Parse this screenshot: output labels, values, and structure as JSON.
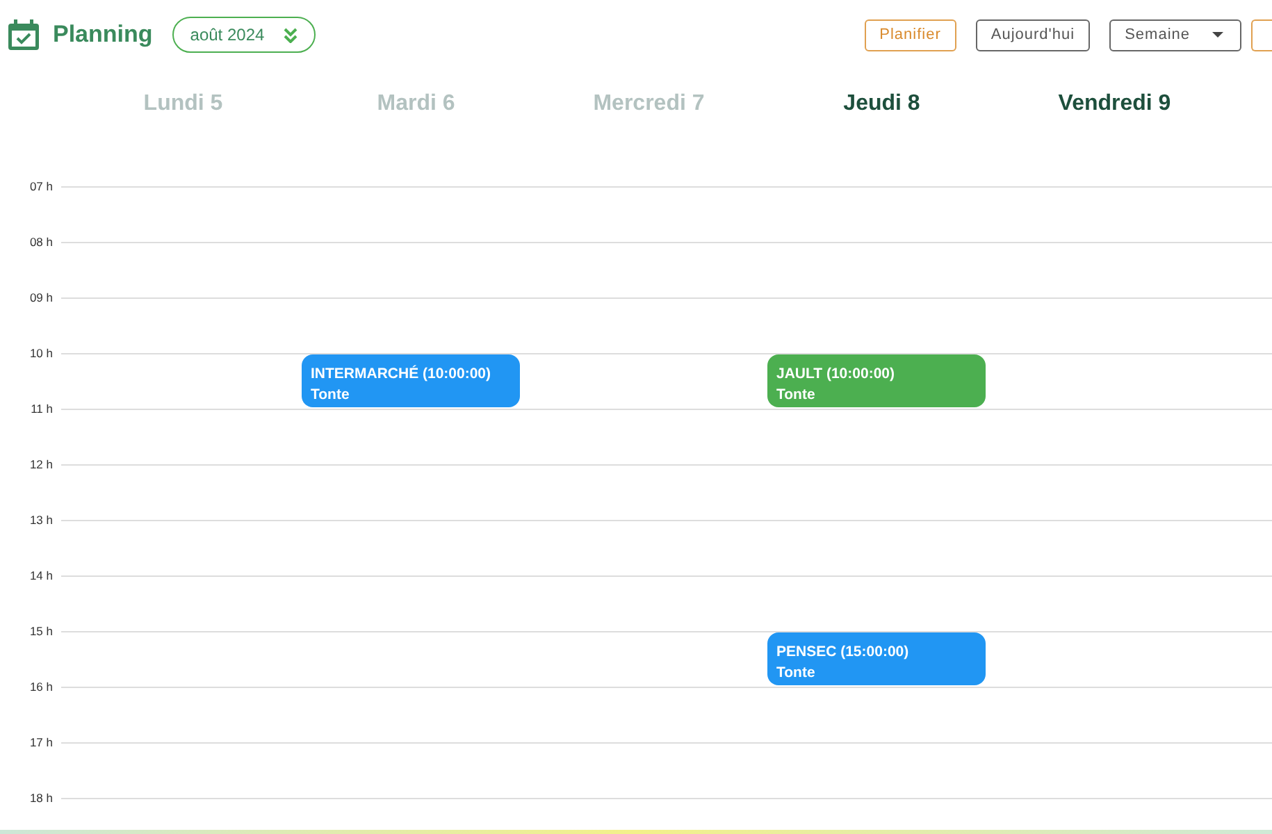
{
  "header": {
    "title": "Planning",
    "month": "août 2024",
    "buttons": [
      {
        "kind": "warning",
        "label": "Planifier"
      },
      {
        "kind": "plain",
        "label": "Aujourd'hui"
      },
      {
        "kind": "dropdown",
        "label": "Semaine"
      },
      {
        "kind": "edge"
      }
    ]
  },
  "days": [
    {
      "label": "Lundi 5",
      "past": true
    },
    {
      "label": "Mardi 6",
      "past": true
    },
    {
      "label": "Mercredi 7",
      "past": true
    },
    {
      "label": "Jeudi 8",
      "past": false
    },
    {
      "label": "Vendredi 9",
      "past": false
    }
  ],
  "hours": [
    {
      "label": "07 h",
      "cells": [
        {
          "kind": "empty"
        },
        {
          "kind": "empty"
        },
        {
          "kind": "empty"
        },
        {
          "kind": "empty"
        },
        {
          "kind": "empty"
        }
      ]
    },
    {
      "label": "08 h",
      "cells": [
        {
          "kind": "empty"
        },
        {
          "kind": "empty"
        },
        {
          "kind": "empty"
        },
        {
          "kind": "empty"
        },
        {
          "kind": "empty"
        }
      ]
    },
    {
      "label": "09 h",
      "cells": [
        {
          "kind": "empty"
        },
        {
          "kind": "empty"
        },
        {
          "kind": "empty"
        },
        {
          "kind": "empty"
        },
        {
          "kind": "empty"
        }
      ]
    },
    {
      "label": "10 h",
      "cells": [
        {
          "kind": "empty"
        },
        {
          "kind": "event",
          "title": "INTERMARCHÉ (10:00:00)",
          "subtitle": "Tonte",
          "color": "#2196f3"
        },
        {
          "kind": "empty"
        },
        {
          "kind": "event",
          "title": "JAULT (10:00:00)",
          "subtitle": "Tonte",
          "color": "#4caf50"
        },
        {
          "kind": "empty"
        }
      ]
    },
    {
      "label": "11 h",
      "cells": [
        {
          "kind": "empty"
        },
        {
          "kind": "empty"
        },
        {
          "kind": "empty"
        },
        {
          "kind": "empty"
        },
        {
          "kind": "empty"
        }
      ]
    },
    {
      "label": "12 h",
      "cells": [
        {
          "kind": "empty"
        },
        {
          "kind": "empty"
        },
        {
          "kind": "empty"
        },
        {
          "kind": "empty"
        },
        {
          "kind": "empty"
        }
      ]
    },
    {
      "label": "13 h",
      "cells": [
        {
          "kind": "empty"
        },
        {
          "kind": "empty"
        },
        {
          "kind": "empty"
        },
        {
          "kind": "empty"
        },
        {
          "kind": "empty"
        }
      ]
    },
    {
      "label": "14 h",
      "cells": [
        {
          "kind": "empty"
        },
        {
          "kind": "empty"
        },
        {
          "kind": "empty"
        },
        {
          "kind": "empty"
        },
        {
          "kind": "empty"
        }
      ]
    },
    {
      "label": "15 h",
      "cells": [
        {
          "kind": "empty"
        },
        {
          "kind": "empty"
        },
        {
          "kind": "empty"
        },
        {
          "kind": "event",
          "title": "PENSEC (15:00:00)",
          "subtitle": "Tonte",
          "color": "#2196f3"
        },
        {
          "kind": "empty"
        }
      ]
    },
    {
      "label": "16 h",
      "cells": [
        {
          "kind": "empty"
        },
        {
          "kind": "empty"
        },
        {
          "kind": "empty"
        },
        {
          "kind": "empty"
        },
        {
          "kind": "empty"
        }
      ]
    },
    {
      "label": "17 h",
      "cells": [
        {
          "kind": "empty"
        },
        {
          "kind": "empty"
        },
        {
          "kind": "empty"
        },
        {
          "kind": "empty"
        },
        {
          "kind": "empty"
        }
      ]
    },
    {
      "label": "18 h",
      "cells": [
        {
          "kind": "empty"
        },
        {
          "kind": "empty"
        },
        {
          "kind": "empty"
        },
        {
          "kind": "empty"
        },
        {
          "kind": "empty"
        }
      ]
    }
  ]
}
